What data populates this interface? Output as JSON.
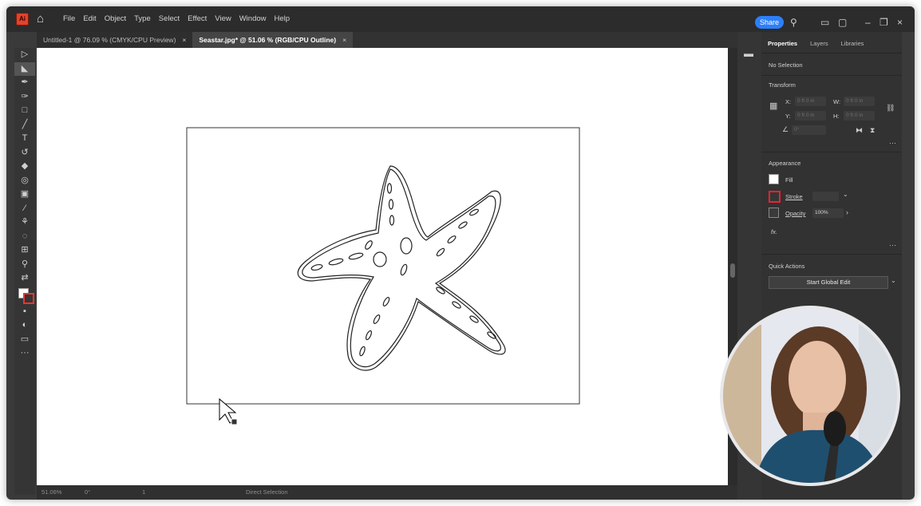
{
  "menu_bar": {
    "app_logo": "Ai",
    "items": [
      "File",
      "Edit",
      "Object",
      "Type",
      "Select",
      "Effect",
      "View",
      "Window",
      "Help"
    ],
    "share_label": "Share"
  },
  "tabs": [
    {
      "label": "Untitled-1 @ 76.09 % (CMYK/CPU Preview)",
      "close": "×"
    },
    {
      "label": "Seastar.jpg* @ 51.06 % (RGB/CPU Outline)",
      "close": "×"
    }
  ],
  "status_bar": {
    "zoom": "51.06%",
    "rotation": "0°",
    "page": "1",
    "tool_name": "Direct Selection"
  },
  "properties_panel": {
    "tabs": [
      "Properties",
      "Layers",
      "Libraries"
    ],
    "selection": "No Selection",
    "transform": {
      "title": "Transform",
      "x_label": "X:",
      "x_value": "0 ft 0 in",
      "y_label": "Y:",
      "y_value": "0 ft 0 in",
      "w_label": "W:",
      "w_value": "0 ft 0 in",
      "h_label": "H:",
      "h_value": "0 ft 0 in",
      "angle_value": "0°"
    },
    "appearance": {
      "title": "Appearance",
      "fill_label": "Fill",
      "stroke_label": "Stroke",
      "opacity_label": "Opacity",
      "opacity_value": "100%",
      "fx_label": "fx."
    },
    "quick_actions": {
      "title": "Quick Actions",
      "global_edit": "Start Global Edit"
    }
  },
  "colors": {
    "accent": "#2d7ff9",
    "app_bg": "#323232",
    "canvas": "#ffffff"
  }
}
